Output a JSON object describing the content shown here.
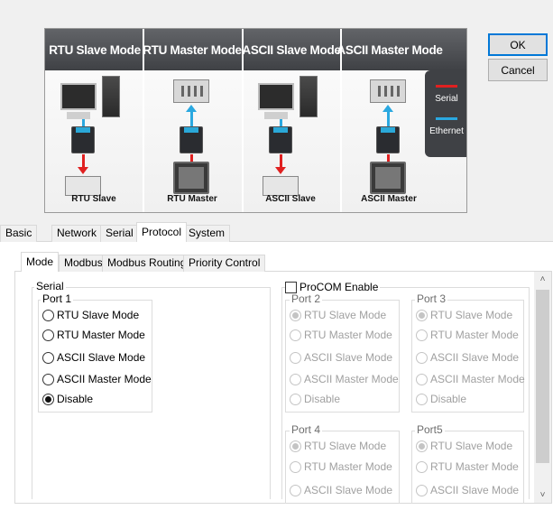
{
  "dialog_buttons": {
    "ok": "OK",
    "cancel": "Cancel"
  },
  "diagram": {
    "columns": [
      {
        "title": "RTU Slave Mode",
        "bottom_label": "RTU Slave"
      },
      {
        "title": "RTU Master Mode",
        "bottom_label": "RTU Master"
      },
      {
        "title": "ASCII Slave Mode",
        "bottom_label": "ASCII Slave"
      },
      {
        "title": "ASCII Master Mode",
        "bottom_label": "ASCII Master"
      }
    ],
    "legend": {
      "serial": "Serial",
      "ethernet": "Ethernet",
      "serial_color": "#e02020",
      "ethernet_color": "#2aa8e0"
    }
  },
  "main_tabs": [
    "Basic",
    "Network",
    "Serial",
    "Protocol",
    "System"
  ],
  "main_tab_active": "Protocol",
  "sub_tabs": [
    "Mode",
    "Modbus",
    "Modbus Routing",
    "Priority Control"
  ],
  "sub_tab_active": "Mode",
  "serial_group": {
    "title": "Serial",
    "port1": {
      "title": "Port 1",
      "options": [
        "RTU Slave Mode",
        "RTU Master Mode",
        "ASCII Slave Mode",
        "ASCII Master Mode",
        "Disable"
      ],
      "selected": "Disable"
    }
  },
  "procom": {
    "label": "ProCOM Enable",
    "checked": false,
    "port2": {
      "title": "Port 2",
      "options": [
        "RTU Slave Mode",
        "RTU Master Mode",
        "ASCII Slave Mode",
        "ASCII Master Mode",
        "Disable"
      ],
      "selected": "RTU Slave Mode"
    },
    "port3": {
      "title": "Port 3",
      "options": [
        "RTU Slave Mode",
        "RTU Master Mode",
        "ASCII Slave Mode",
        "ASCII Master Mode",
        "Disable"
      ],
      "selected": "RTU Slave Mode"
    },
    "port4": {
      "title": "Port 4",
      "options": [
        "RTU Slave Mode",
        "RTU Master Mode",
        "ASCII Slave Mode"
      ],
      "selected": "RTU Slave Mode"
    },
    "port5": {
      "title": "Port5",
      "options": [
        "RTU Slave Mode",
        "RTU Master Mode",
        "ASCII Slave Mode"
      ],
      "selected": "RTU Slave Mode"
    }
  },
  "icons": {
    "scroll_up": "scroll-up-arrow-icon",
    "scroll_down": "scroll-down-arrow-icon"
  }
}
